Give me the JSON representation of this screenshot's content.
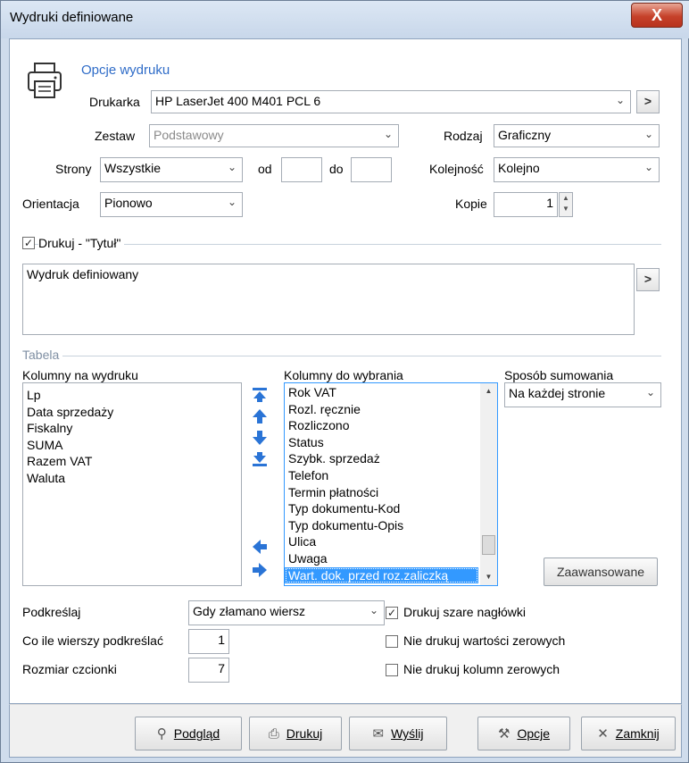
{
  "window": {
    "title": "Wydruki definiowane",
    "close_label": "X"
  },
  "print_options": {
    "section_title": "Opcje wydruku",
    "printer_label": "Drukarka",
    "printer_value": "HP LaserJet 400 M401 PCL 6",
    "set_label": "Zestaw",
    "set_value": "Podstawowy",
    "type_label": "Rodzaj",
    "type_value": "Graficzny",
    "pages_label": "Strony",
    "pages_value": "Wszystkie",
    "from_label": "od",
    "from_value": "",
    "to_label": "do",
    "to_value": "",
    "order_label": "Kolejność",
    "order_value": "Kolejno",
    "orientation_label": "Orientacja",
    "orientation_value": "Pionowo",
    "copies_label": "Kopie",
    "copies_value": "1",
    "more_glyph": ">"
  },
  "title_section": {
    "checkbox_label": "Drukuj - \"Tytuł\"",
    "checked": true,
    "title_text": "Wydruk definiowany"
  },
  "table": {
    "section_title": "Tabela",
    "print_columns_label": "Kolumny na wydruku",
    "print_columns": [
      "Lp",
      "Data sprzedaży",
      "Fiskalny",
      "SUMA",
      "Razem VAT",
      "Waluta"
    ],
    "available_label": "Kolumny do wybrania",
    "available_columns": [
      "Rok VAT",
      "Rozl. ręcznie",
      "Rozliczono",
      "Status",
      "Szybk. sprzedaż",
      "Telefon",
      "Termin płatności",
      "Typ dokumentu-Kod",
      "Typ dokumentu-Opis",
      "Ulica",
      "Uwaga",
      "Wart. dok. przed roz.zaliczką"
    ],
    "selected_available": "Wart. dok. przed roz.zaliczką",
    "sum_label": "Sposób sumowania",
    "sum_value": "Na każdej stronie",
    "advanced_label": "Zaawansowane"
  },
  "format": {
    "underline_label": "Podkreślaj",
    "underline_value": "Gdy złamano wiersz",
    "every_rows_label": "Co ile wierszy podkreślać",
    "every_rows_value": "1",
    "font_size_label": "Rozmiar czcionki",
    "font_size_value": "7",
    "gray_headers_label": "Drukuj szare nagłówki",
    "gray_headers_checked": true,
    "no_zero_values_label": "Nie drukuj wartości zerowych",
    "no_zero_columns_label": "Nie drukuj kolumn zerowych"
  },
  "buttons": {
    "preview": "Podgląd",
    "print": "Drukuj",
    "send": "Wyślij",
    "options": "Opcje",
    "close": "Zamknij"
  },
  "colors": {
    "accent": "#3399ff",
    "title_blue": "#2f6cc8",
    "arrow_blue": "#2a74d6"
  }
}
